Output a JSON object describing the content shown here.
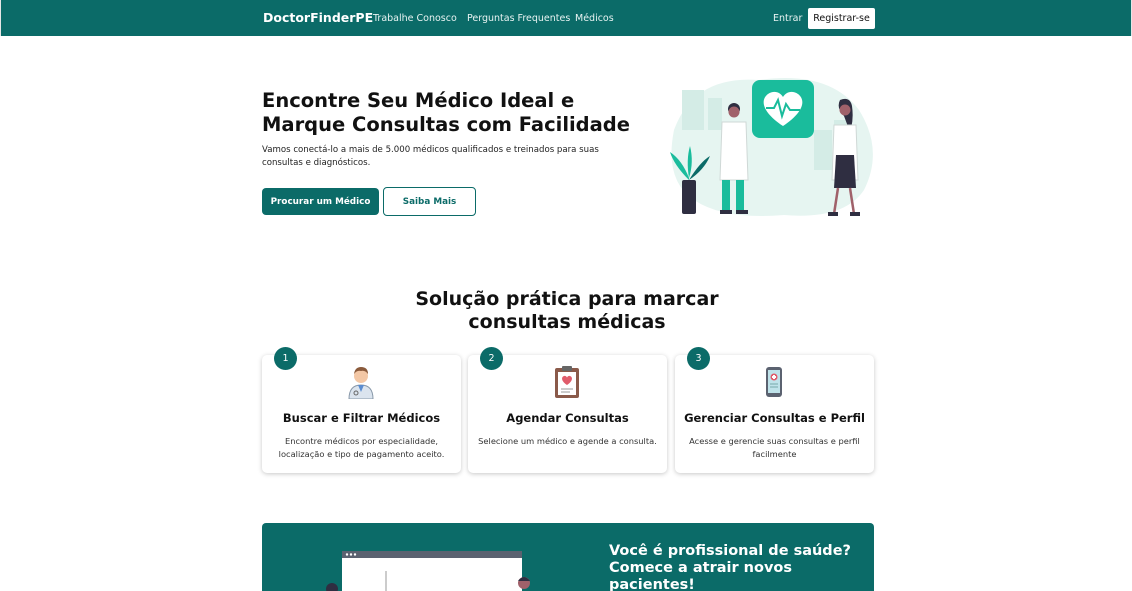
{
  "navbar": {
    "brand": "DoctorFinderPE",
    "links": [
      "Trabalhe Conosco",
      "Perguntas Frequentes",
      "Médicos"
    ],
    "login": "Entrar",
    "register": "Registrar-se"
  },
  "hero": {
    "title": "Encontre Seu Médico Ideal e Marque Consultas com Facilidade",
    "subtitle": "Vamos conectá-lo a mais de 5.000 médicos qualificados e treinados para suas consultas e diagnósticos.",
    "primary_button": "Procurar um Médico",
    "secondary_button": "Saiba Mais"
  },
  "steps": {
    "title": "Solução prática para marcar consultas médicas",
    "cards": [
      {
        "number": "1",
        "icon": "doctor-icon",
        "title": "Buscar e Filtrar Médicos",
        "description": "Encontre médicos por especialidade, localização e tipo de pagamento aceito."
      },
      {
        "number": "2",
        "icon": "clipboard-heart-icon",
        "title": "Agendar Consultas",
        "description": "Selecione um médico e agende a consulta."
      },
      {
        "number": "3",
        "icon": "phone-medical-icon",
        "title": "Gerenciar Consultas e Perfil",
        "description": "Acesse e gerencie suas consultas e perfil facilmente"
      }
    ]
  },
  "banner": {
    "title": "Você é profissional de saúde? Comece a atrair novos pacientes!"
  },
  "colors": {
    "primary": "#0b6b68",
    "accent": "#1abc9c"
  }
}
